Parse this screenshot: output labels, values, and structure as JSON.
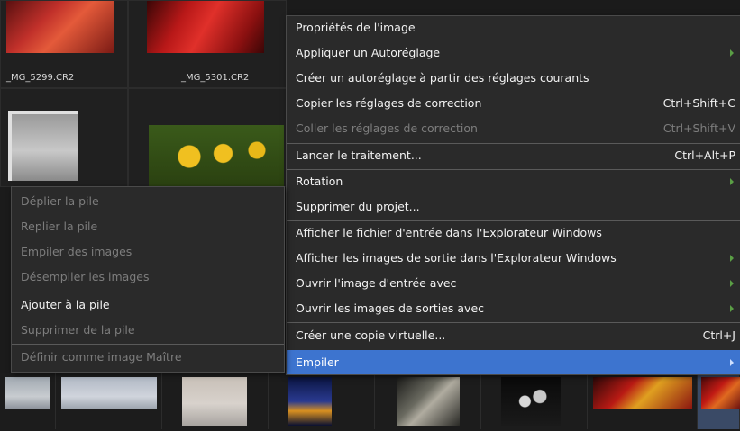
{
  "thumbnails": {
    "top_row_filenames": [
      "_MG_5299.CR2",
      "_MG_5301.CR2"
    ]
  },
  "context_menu": {
    "items": [
      {
        "label": "Propriétés de l'image",
        "shortcut": "",
        "submenu": false,
        "disabled": false
      },
      {
        "label": "Appliquer un Autoréglage",
        "shortcut": "",
        "submenu": true,
        "disabled": false
      },
      {
        "label": "Créer un autoréglage à partir des réglages courants",
        "shortcut": "",
        "submenu": false,
        "disabled": false
      },
      {
        "label": "Copier les réglages de correction",
        "shortcut": "Ctrl+Shift+C",
        "submenu": false,
        "disabled": false
      },
      {
        "label": "Coller les réglages de correction",
        "shortcut": "Ctrl+Shift+V",
        "submenu": false,
        "disabled": true
      },
      {
        "label": "Lancer le traitement...",
        "shortcut": "Ctrl+Alt+P",
        "submenu": false,
        "disabled": false
      },
      {
        "label": "Rotation",
        "shortcut": "",
        "submenu": true,
        "disabled": false
      },
      {
        "label": "Supprimer du projet...",
        "shortcut": "",
        "submenu": false,
        "disabled": false
      },
      {
        "label": "Afficher le fichier d'entrée dans l'Explorateur Windows",
        "shortcut": "",
        "submenu": false,
        "disabled": false
      },
      {
        "label": "Afficher les images de sortie dans l'Explorateur Windows",
        "shortcut": "",
        "submenu": true,
        "disabled": false
      },
      {
        "label": "Ouvrir l'image d'entrée avec",
        "shortcut": "",
        "submenu": true,
        "disabled": false
      },
      {
        "label": "Ouvrir les images de sorties avec",
        "shortcut": "",
        "submenu": true,
        "disabled": false
      },
      {
        "label": "Créer une copie virtuelle...",
        "shortcut": "Ctrl+J",
        "submenu": false,
        "disabled": false
      },
      {
        "label": "Empiler",
        "shortcut": "",
        "submenu": true,
        "disabled": false,
        "selected": true
      }
    ]
  },
  "stack_submenu": {
    "items": [
      {
        "label": "Déplier la pile",
        "disabled": true
      },
      {
        "label": "Replier la pile",
        "disabled": true
      },
      {
        "label": "Empiler des images",
        "disabled": true
      },
      {
        "label": "Désempiler les images",
        "disabled": true
      },
      {
        "label": "Ajouter à la pile",
        "disabled": false
      },
      {
        "label": "Supprimer de la pile",
        "disabled": true
      },
      {
        "label": "Définir comme image Maître",
        "disabled": true
      }
    ]
  },
  "colors": {
    "menu_bg": "#2a2a2a",
    "selection": "#3d74cf",
    "submenu_arrow": "#5a9e45",
    "disabled_text": "#7d7d7d"
  }
}
